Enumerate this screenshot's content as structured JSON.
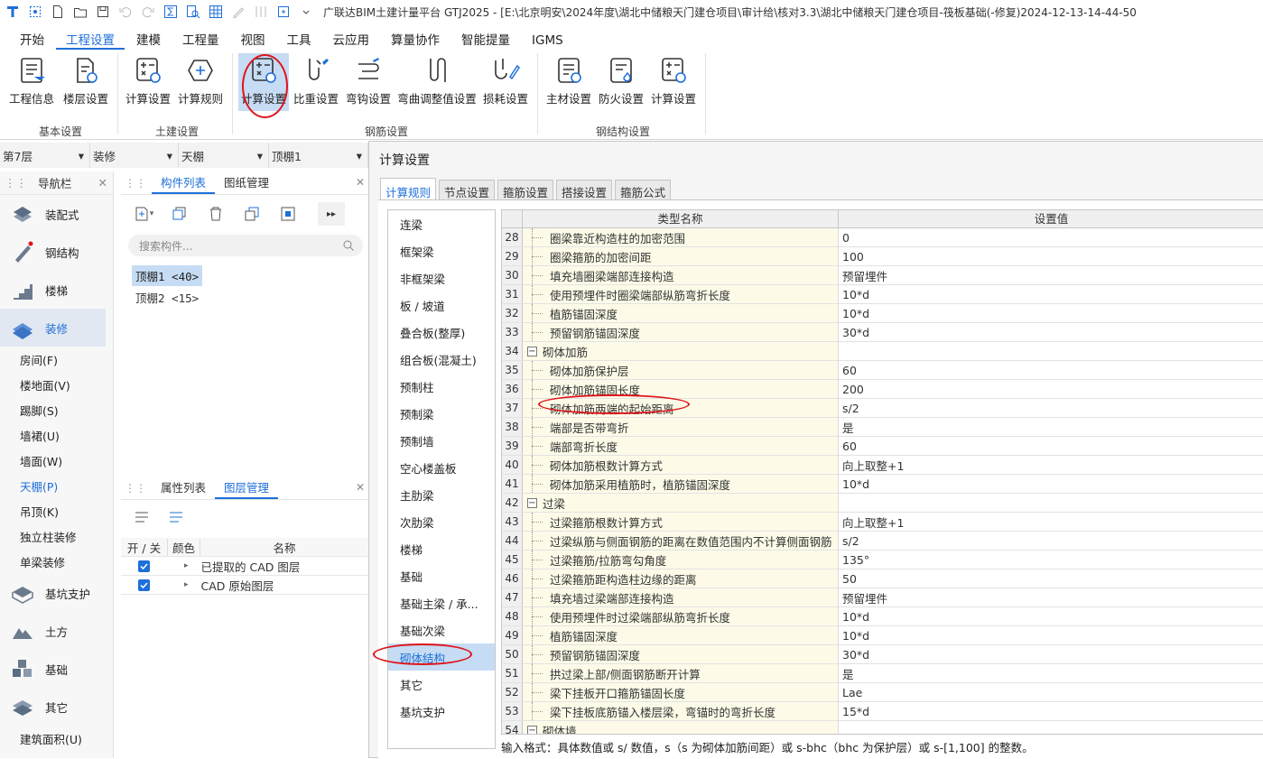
{
  "titlebar": {
    "title": "广联达BIM土建计量平台 GTJ2025 - [E:\\北京明安\\2024年度\\湖北中储粮天门建仓项目\\审计给\\核对3.3\\湖北中储粮天门建仓项目-筏板基础(-修复)2024-12-13-14-44-50"
  },
  "menu": [
    "开始",
    "工程设置",
    "建模",
    "工程量",
    "视图",
    "工具",
    "云应用",
    "算量协作",
    "智能提量",
    "IGMS"
  ],
  "ribbon": {
    "groups": [
      {
        "label": "基本设置",
        "buttons": [
          "工程信息",
          "楼层设置"
        ]
      },
      {
        "label": "土建设置",
        "buttons": [
          "计算设置",
          "计算规则"
        ]
      },
      {
        "label": "钢筋设置",
        "buttons": [
          "计算设置",
          "比重设置",
          "弯钩设置",
          "弯曲调整值设置",
          "损耗设置"
        ]
      },
      {
        "label": "钢结构设置",
        "buttons": [
          "主材设置",
          "防火设置",
          "计算设置"
        ]
      }
    ]
  },
  "selectors": [
    "第7层",
    "装修",
    "天棚",
    "顶棚1"
  ],
  "nav": {
    "title": "导航栏",
    "top_items": [
      "装配式",
      "钢结构",
      "楼梯",
      "装修"
    ],
    "sub_items": [
      "房间(F)",
      "楼地面(V)",
      "踢脚(S)",
      "墙裙(U)",
      "墙面(W)",
      "天棚(P)",
      "吊顶(K)",
      "独立柱装修",
      "单梁装修"
    ],
    "bottom_items": [
      "基坑支护",
      "土方",
      "基础",
      "其它"
    ],
    "last_item": "建筑面积(U)"
  },
  "components": {
    "tabs": [
      "构件列表",
      "图纸管理"
    ],
    "search_placeholder": "搜索构件...",
    "items": [
      "顶棚1 <40>",
      "顶棚2 <15>"
    ]
  },
  "layers": {
    "tabs": [
      "属性列表",
      "图层管理"
    ],
    "headers": [
      "开 / 关",
      "颜色",
      "名称"
    ],
    "rows": [
      "已提取的 CAD 图层",
      "CAD 原始图层"
    ]
  },
  "dialog": {
    "title": "计算设置",
    "tabs": [
      "计算规则",
      "节点设置",
      "箍筋设置",
      "搭接设置",
      "箍筋公式"
    ],
    "categories": [
      "连梁",
      "框架梁",
      "非框架梁",
      "板 / 坡道",
      "叠合板(整厚)",
      "组合板(混凝土)",
      "预制柱",
      "预制梁",
      "预制墙",
      "空心楼盖板",
      "主肋梁",
      "次肋梁",
      "楼梯",
      "基础",
      "基础主梁 / 承...",
      "基础次梁",
      "砌体结构",
      "其它",
      "基坑支护"
    ],
    "grid_headers": [
      "类型名称",
      "设置值"
    ],
    "rows": [
      {
        "n": "28",
        "name": "圈梁靠近构造柱的加密范围",
        "value": "0"
      },
      {
        "n": "29",
        "name": "圈梁箍筋的加密间距",
        "value": "100"
      },
      {
        "n": "30",
        "name": "填充墙圈梁端部连接构造",
        "value": "预留埋件"
      },
      {
        "n": "31",
        "name": "使用预埋件时圈梁端部纵筋弯折长度",
        "value": "10*d"
      },
      {
        "n": "32",
        "name": "植筋锚固深度",
        "value": "10*d"
      },
      {
        "n": "33",
        "name": "预留钢筋锚固深度",
        "value": "30*d"
      },
      {
        "n": "34",
        "name": "砌体加筋",
        "value": "",
        "group": true
      },
      {
        "n": "35",
        "name": "砌体加筋保护层",
        "value": "60"
      },
      {
        "n": "36",
        "name": "砌体加筋锚固长度",
        "value": "200"
      },
      {
        "n": "37",
        "name": "砌体加筋两端的起始距离",
        "value": "s/2"
      },
      {
        "n": "38",
        "name": "端部是否带弯折",
        "value": "是"
      },
      {
        "n": "39",
        "name": "端部弯折长度",
        "value": "60"
      },
      {
        "n": "40",
        "name": "砌体加筋根数计算方式",
        "value": "向上取整+1"
      },
      {
        "n": "41",
        "name": "砌体加筋采用植筋时，植筋锚固深度",
        "value": "10*d"
      },
      {
        "n": "42",
        "name": "过梁",
        "value": "",
        "group": true
      },
      {
        "n": "43",
        "name": "过梁箍筋根数计算方式",
        "value": "向上取整+1"
      },
      {
        "n": "44",
        "name": "过梁纵筋与侧面钢筋的距离在数值范围内不计算侧面钢筋",
        "value": "s/2"
      },
      {
        "n": "45",
        "name": "过梁箍筋/拉筋弯勾角度",
        "value": "135°"
      },
      {
        "n": "46",
        "name": "过梁箍筋距构造柱边缘的距离",
        "value": "50"
      },
      {
        "n": "47",
        "name": "填充墙过梁端部连接构造",
        "value": "预留埋件"
      },
      {
        "n": "48",
        "name": "使用预埋件时过梁端部纵筋弯折长度",
        "value": "10*d"
      },
      {
        "n": "49",
        "name": "植筋锚固深度",
        "value": "10*d"
      },
      {
        "n": "50",
        "name": "预留钢筋锚固深度",
        "value": "30*d"
      },
      {
        "n": "51",
        "name": "拱过梁上部/侧面钢筋断开计算",
        "value": "是"
      },
      {
        "n": "52",
        "name": "梁下挂板开口箍筋锚固长度",
        "value": "Lae"
      },
      {
        "n": "53",
        "name": "梁下挂板底筋锚入楼层梁，弯锚时的弯折长度",
        "value": "15*d"
      },
      {
        "n": "54",
        "name": "砌体墙",
        "value": "",
        "group": true
      }
    ],
    "hint": "输入格式：具体数值或 s/ 数值，s（s 为砌体加筋间距）或 s-bhc（bhc 为保护层）或 s-[1,100] 的整数。"
  }
}
